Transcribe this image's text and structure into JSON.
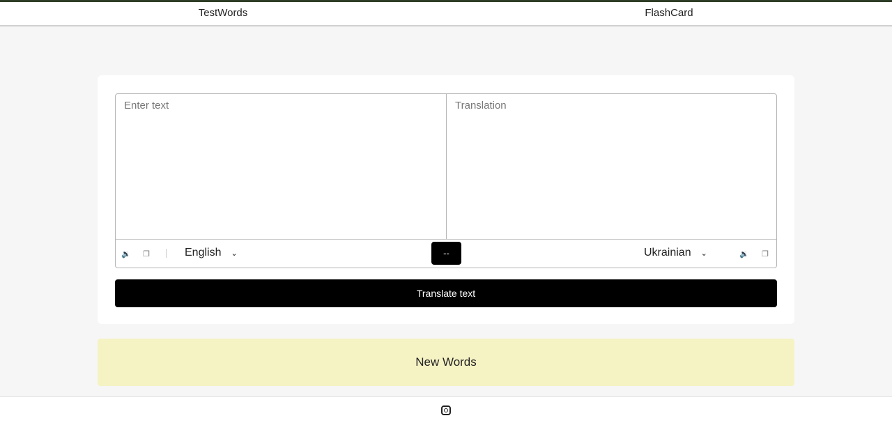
{
  "nav": {
    "items": [
      {
        "label": "TestWords"
      },
      {
        "label": "FlashCard"
      }
    ]
  },
  "translator": {
    "source_placeholder": "Enter text",
    "target_placeholder": "Translation",
    "source_language": "English",
    "target_language": "Ukrainian",
    "swap_label": "--",
    "translate_label": "Translate text",
    "icons": {
      "speaker": "🔉",
      "copy": "❐",
      "chevron": "⌄"
    }
  },
  "new_words": {
    "label": "New Words"
  },
  "footer": {
    "icon": "instagram-icon"
  }
}
